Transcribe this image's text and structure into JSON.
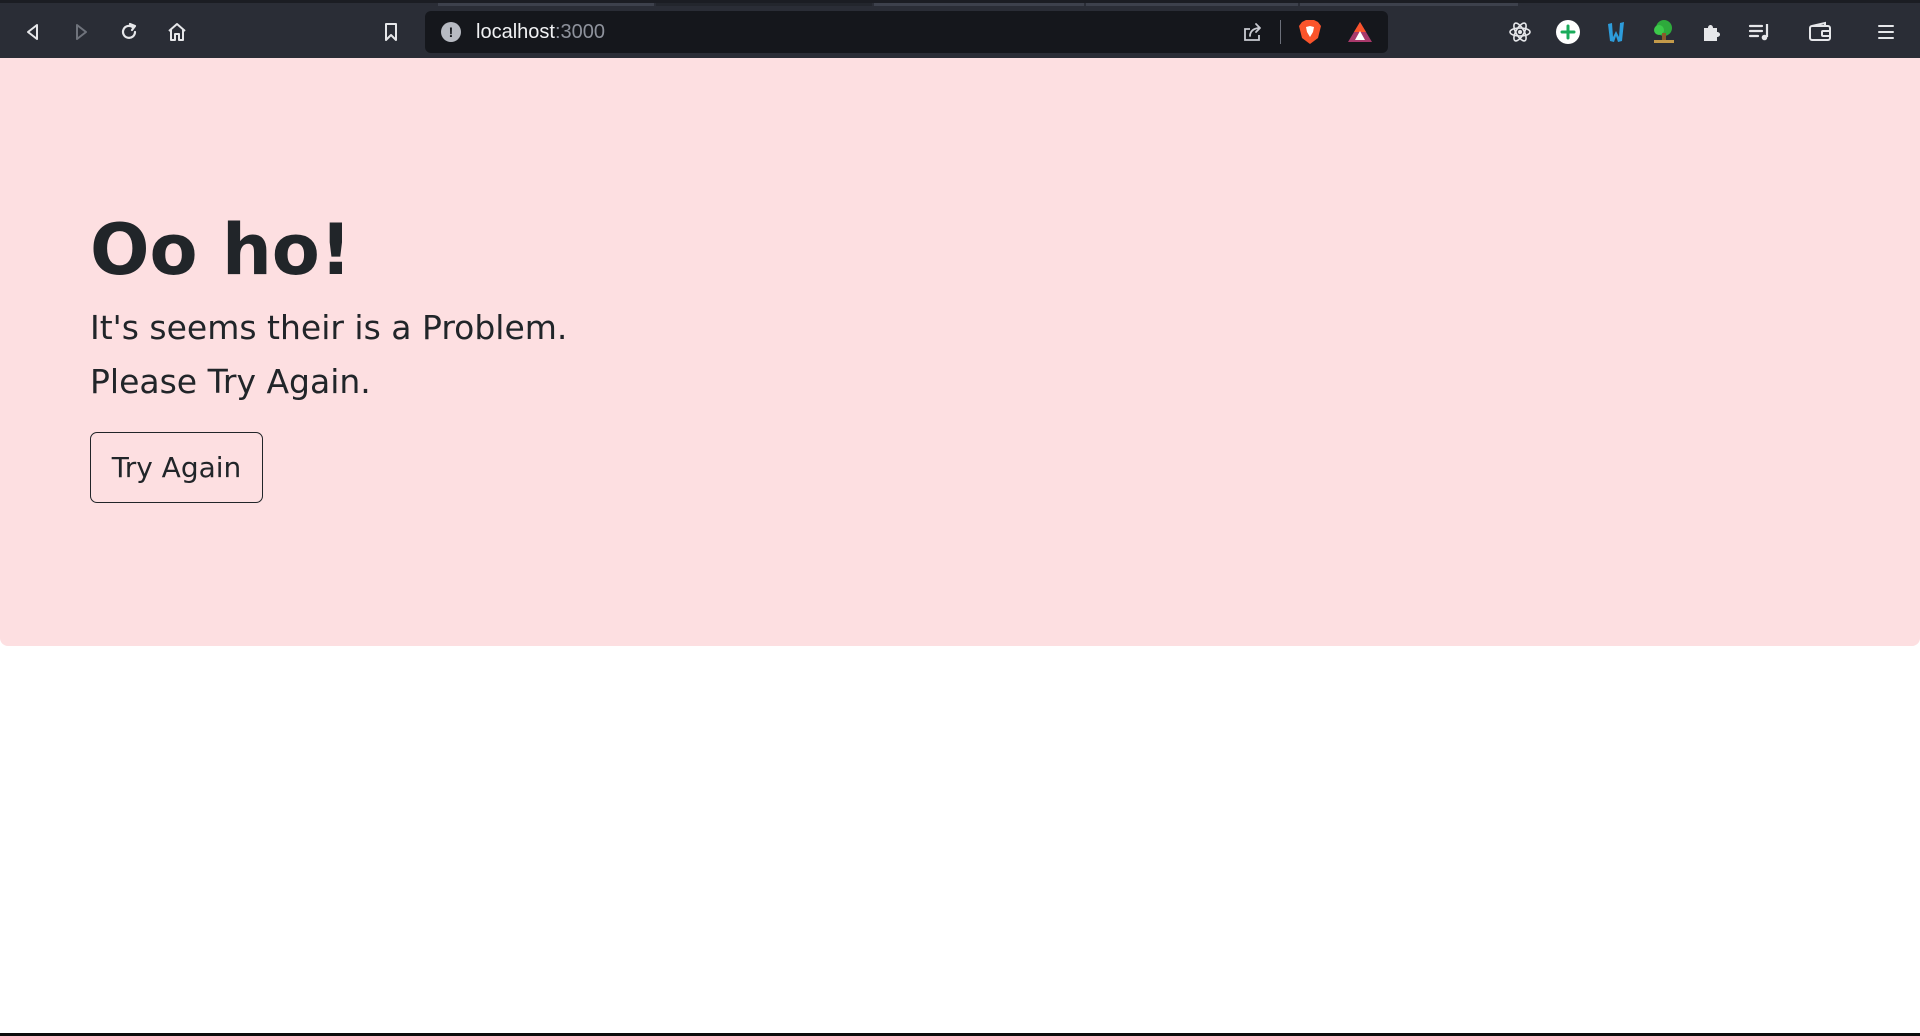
{
  "browser": {
    "url_host": "localhost",
    "url_port": ":3000",
    "toolbar_icons": [
      "back-icon",
      "forward-icon",
      "reload-icon",
      "home-icon",
      "bookmark-icon",
      "site-info-icon",
      "share-icon",
      "brave-shields-icon",
      "brave-rewards-icon",
      "react-devtools-icon",
      "add-extension-icon",
      "wappalyzer-icon",
      "tree-extension-icon",
      "extensions-puzzle-icon",
      "playlist-icon",
      "wallet-icon",
      "menu-icon"
    ]
  },
  "alert": {
    "title": "Oo ho!",
    "line1": "It's seems their is a Problem.",
    "line2": "Please Try Again.",
    "button_label": "Try Again"
  },
  "colors": {
    "toolbar_bg": "#2a2d36",
    "urlbar_bg": "#15171c",
    "alert_bg": "#fddfe1",
    "text": "#212529",
    "brave_orange": "#fb542b"
  }
}
